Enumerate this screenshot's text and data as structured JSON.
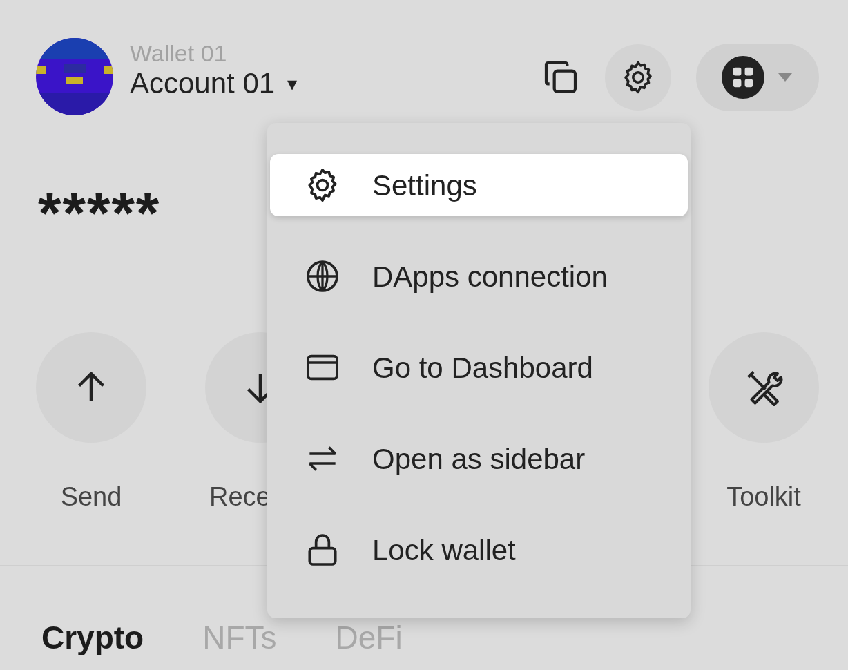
{
  "header": {
    "wallet_name": "Wallet 01",
    "account_name": "Account 01",
    "account_caret": "▾"
  },
  "balance": "*****",
  "actions": [
    {
      "kind": "send",
      "label": "Send"
    },
    {
      "kind": "receive",
      "label": "Rece"
    },
    {
      "kind": "toolkit",
      "label": "Toolkit"
    }
  ],
  "tabs": [
    {
      "label": "Crypto",
      "selected": true
    },
    {
      "label": "NFTs",
      "selected": false
    },
    {
      "label": "DeFi",
      "selected": false
    }
  ],
  "menu": {
    "items": [
      {
        "kind": "settings",
        "label": "Settings",
        "selected": true
      },
      {
        "kind": "globe",
        "label": "DApps connection",
        "selected": false
      },
      {
        "kind": "dashboard",
        "label": "Go to Dashboard",
        "selected": false
      },
      {
        "kind": "sidebar",
        "label": "Open as sidebar",
        "selected": false
      },
      {
        "kind": "lock",
        "label": "Lock wallet",
        "selected": false
      }
    ]
  }
}
